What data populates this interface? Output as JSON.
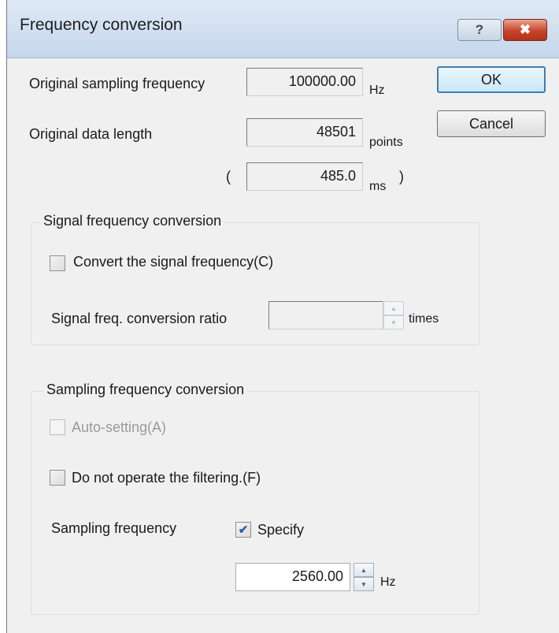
{
  "window": {
    "title": "Frequency conversion",
    "help_icon": "?",
    "close_icon": "✖"
  },
  "buttons": {
    "ok": "OK",
    "cancel": "Cancel"
  },
  "original": {
    "sampling_label": "Original sampling frequency",
    "sampling_value": "100000.00",
    "sampling_unit": "Hz",
    "length_label": "Original data length",
    "length_value": "48501",
    "length_unit": "points",
    "open_paren": "(",
    "duration_value": "485.0",
    "duration_unit": "ms",
    "close_paren": ")"
  },
  "signal_group": {
    "title": "Signal frequency conversion",
    "convert_label": "Convert the signal frequency(C)",
    "convert_checked": false,
    "ratio_label": "Signal freq. conversion ratio",
    "ratio_value": "",
    "ratio_unit": "times"
  },
  "sampling_group": {
    "title": "Sampling frequency conversion",
    "auto_label": "Auto-setting(A)",
    "auto_checked": false,
    "nofilter_label": "Do not operate the filtering.(F)",
    "nofilter_checked": false,
    "freq_label": "Sampling frequency",
    "specify_label": "Specify",
    "specify_checked": true,
    "freq_value": "2560.00",
    "freq_unit": "Hz"
  },
  "icons": {
    "check_mark": "✔",
    "spin_up": "▲",
    "spin_down": "▼"
  }
}
